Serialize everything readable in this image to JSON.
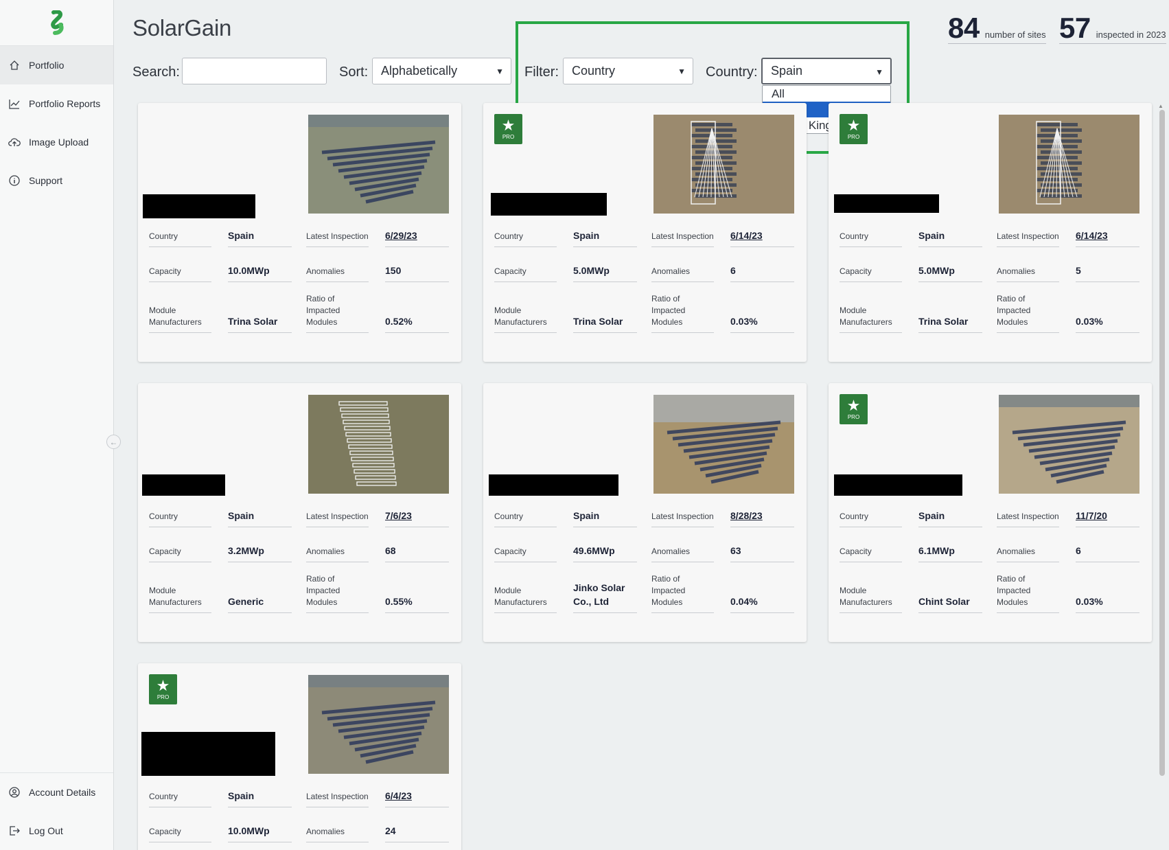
{
  "app": {
    "title": "SolarGain"
  },
  "nav": {
    "items": [
      {
        "label": "Portfolio",
        "icon": "home-icon"
      },
      {
        "label": "Portfolio Reports",
        "icon": "chart-icon"
      },
      {
        "label": "Image Upload",
        "icon": "cloud-upload-icon"
      },
      {
        "label": "Support",
        "icon": "info-icon"
      }
    ],
    "bottom": [
      {
        "label": "Account Details",
        "icon": "user-icon"
      },
      {
        "label": "Log Out",
        "icon": "logout-icon"
      }
    ]
  },
  "stats": {
    "sites": {
      "value": "84",
      "label": "number of sites"
    },
    "inspected": {
      "value": "57",
      "label": "inspected in 2023"
    }
  },
  "controls": {
    "search_label": "Search:",
    "search_value": "",
    "sort_label": "Sort:",
    "sort_value": "Alphabetically",
    "filter_label": "Filter:",
    "filter_value": "Country",
    "country_label": "Country:",
    "country_value": "Spain",
    "country_options": [
      "All",
      "Spain",
      "United Kingdom"
    ]
  },
  "labels": {
    "country": "Country",
    "capacity": "Capacity",
    "module1": "Module",
    "module2": "Manufacturers",
    "latest": "Latest Inspection",
    "anomalies": "Anomalies",
    "ratio1": "Ratio of",
    "ratio2": "Impacted",
    "ratio3": "Modules",
    "pro": "PRO"
  },
  "sites": [
    {
      "pro": false,
      "country": "Spain",
      "capacity": "10.0MWp",
      "manufacturer": "Trina Solar",
      "inspection": "6/29/23",
      "anomalies": "150",
      "ratio": "0.52%"
    },
    {
      "pro": true,
      "country": "Spain",
      "capacity": "5.0MWp",
      "manufacturer": "Trina Solar",
      "inspection": "6/14/23",
      "anomalies": "6",
      "ratio": "0.03%"
    },
    {
      "pro": true,
      "country": "Spain",
      "capacity": "5.0MWp",
      "manufacturer": "Trina Solar",
      "inspection": "6/14/23",
      "anomalies": "5",
      "ratio": "0.03%"
    },
    {
      "pro": false,
      "country": "Spain",
      "capacity": "3.2MWp",
      "manufacturer": "Generic",
      "inspection": "7/6/23",
      "anomalies": "68",
      "ratio": "0.55%"
    },
    {
      "pro": false,
      "country": "Spain",
      "capacity": "49.6MWp",
      "manufacturer": "Jinko Solar Co., Ltd",
      "inspection": "8/28/23",
      "anomalies": "63",
      "ratio": "0.04%"
    },
    {
      "pro": true,
      "country": "Spain",
      "capacity": "6.1MWp",
      "manufacturer": "Chint Solar",
      "inspection": "11/7/20",
      "anomalies": "6",
      "ratio": "0.03%"
    },
    {
      "pro": true,
      "country": "Spain",
      "capacity": "10.0MWp",
      "manufacturer": "",
      "inspection": "6/4/23",
      "anomalies": "24",
      "ratio": ""
    }
  ],
  "colors": {
    "accent_green": "#28a745",
    "pro_green": "#2e7d3a",
    "selected_blue": "#1f62c6"
  }
}
